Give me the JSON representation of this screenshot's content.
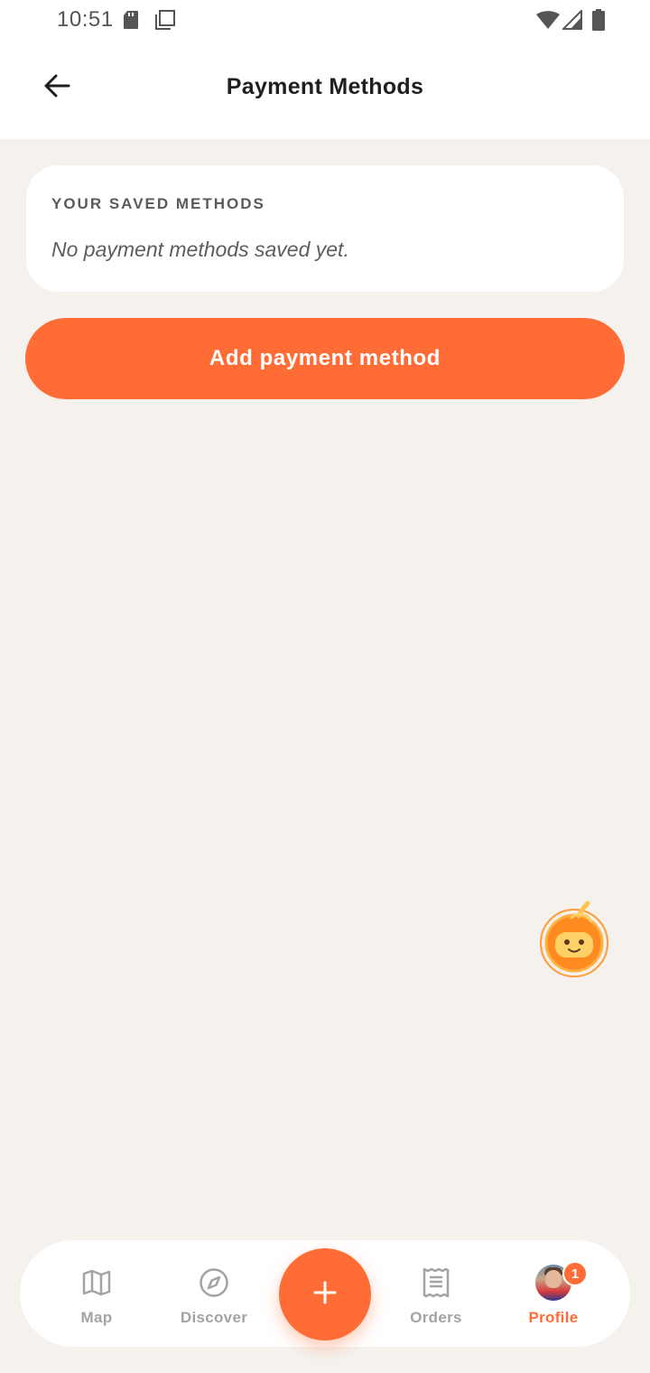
{
  "status_bar": {
    "time": "10:51",
    "icons": [
      "sd-card-icon",
      "screenshot-icon",
      "wifi-icon",
      "cell-signal-icon",
      "battery-icon"
    ]
  },
  "header": {
    "title": "Payment Methods",
    "back_icon": "arrow-left-icon"
  },
  "saved_methods": {
    "heading": "YOUR SAVED METHODS",
    "empty_text": "No payment methods saved yet."
  },
  "add_button": {
    "label": "Add payment method"
  },
  "assistant": {
    "icon": "robot-mascot-icon"
  },
  "bottom_nav": {
    "items": [
      {
        "label": "Map",
        "icon": "map-icon",
        "active": false
      },
      {
        "label": "Discover",
        "icon": "compass-icon",
        "active": false
      },
      {
        "label": "Orders",
        "icon": "receipt-icon",
        "active": false
      },
      {
        "label": "Profile",
        "icon": "avatar",
        "active": true
      }
    ],
    "center_icon": "plus-icon",
    "profile_badge": "1"
  },
  "colors": {
    "accent": "#ff6c35",
    "background": "#f5f2ee",
    "card": "#ffffff",
    "inactive_nav": "#a3a3a3"
  }
}
